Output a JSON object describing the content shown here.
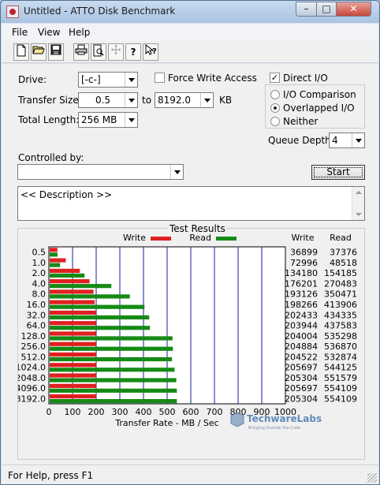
{
  "window": {
    "title": "Untitled - ATTO Disk Benchmark"
  },
  "titlebar": {
    "minimize": "–",
    "maximize": "□",
    "close": "✕"
  },
  "menu": {
    "file": "File",
    "view": "View",
    "help": "Help"
  },
  "toolbar": {
    "icons": [
      "new-icon",
      "open-icon",
      "save-icon",
      "print-icon",
      "print-preview-icon",
      "move-icon",
      "help-icon",
      "context-help-icon"
    ]
  },
  "form": {
    "drive_label": "Drive:",
    "drive_value": "[-c-]",
    "transfer_size_label": "Transfer Size:",
    "transfer_from": "0.5",
    "transfer_to_label": "to",
    "transfer_to": "8192.0",
    "transfer_unit": "KB",
    "total_length_label": "Total Length:",
    "total_length_value": "256 MB",
    "force_write_access_label": "Force Write Access",
    "force_write_access_checked": false,
    "direct_io_label": "Direct I/O",
    "direct_io_checked": true,
    "io_comparison_label": "I/O Comparison",
    "overlapped_io_label": "Overlapped I/O",
    "neither_label": "Neither",
    "selected_io_mode": "Overlapped I/O",
    "queue_depth_label": "Queue Depth:",
    "queue_depth_value": "4",
    "controlled_by_label": "Controlled by:",
    "controlled_by_value": "",
    "start_label": "Start",
    "description": "<< Description >>"
  },
  "results": {
    "title": "Test Results"
  },
  "chart_data": {
    "type": "bar",
    "orientation": "horizontal",
    "categories": [
      "0.5",
      "1.0",
      "2.0",
      "4.0",
      "8.0",
      "16.0",
      "32.0",
      "64.0",
      "128.0",
      "256.0",
      "512.0",
      "1024.0",
      "2048.0",
      "4096.0",
      "8192.0"
    ],
    "series": [
      {
        "name": "Write",
        "color": "#e02020",
        "values": [
          36899,
          72996,
          134180,
          176201,
          193126,
          198266,
          202433,
          203944,
          204004,
          204884,
          204522,
          205697,
          205304,
          205697,
          205304
        ]
      },
      {
        "name": "Read",
        "color": "#168a16",
        "values": [
          37376,
          48518,
          154185,
          270483,
          350471,
          413906,
          434335,
          437583,
          535298,
          536870,
          532874,
          544125,
          551579,
          554109,
          554109
        ]
      }
    ],
    "value_columns": {
      "write_header": "Write",
      "read_header": "Read"
    },
    "xlabel": "Transfer Rate - MB / Sec",
    "xticks": [
      "0",
      "100",
      "200",
      "300",
      "400",
      "500",
      "600",
      "700",
      "800",
      "900",
      "1000"
    ],
    "xlim": [
      0,
      1000
    ],
    "legend": "top",
    "grid": true
  },
  "watermark": {
    "text": "TechwareLabs",
    "tagline": "Bringing Outside the Cube"
  },
  "status": {
    "text": "For Help, press F1"
  }
}
